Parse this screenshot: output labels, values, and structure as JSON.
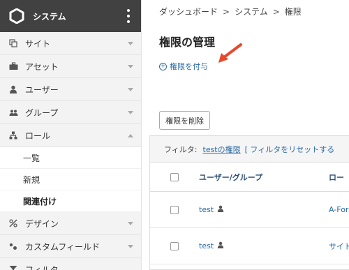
{
  "sidebar": {
    "title": "システム",
    "items": [
      {
        "label": "サイト",
        "icon": "copy-icon",
        "expanded": false
      },
      {
        "label": "アセット",
        "icon": "briefcase-icon",
        "expanded": false
      },
      {
        "label": "ユーザー",
        "icon": "user-icon",
        "expanded": false
      },
      {
        "label": "グループ",
        "icon": "group-icon",
        "expanded": false
      },
      {
        "label": "ロール",
        "icon": "sitemap-icon",
        "expanded": true
      }
    ],
    "role_submenu": [
      "一覧",
      "新規",
      "関連付け"
    ],
    "active_submenu": "関連付け",
    "items_after": [
      {
        "label": "デザイン",
        "icon": "design-icon"
      },
      {
        "label": "カスタムフィールド",
        "icon": "custom-field-icon"
      },
      {
        "label": "フィルタ",
        "icon": "filter-icon"
      }
    ]
  },
  "breadcrumb": {
    "items": [
      "ダッシュボード",
      "システム",
      "権限"
    ],
    "separator": ">"
  },
  "page": {
    "title": "権限の管理",
    "grant_label": "権限を付与",
    "delete_label": "権限を削除"
  },
  "filter": {
    "label": "フィルタ:",
    "current": "testの権限",
    "reset": "[ フィルタをリセットする"
  },
  "table": {
    "headers": [
      "ユーザー/グループ",
      "ロー"
    ],
    "rows": [
      {
        "user": "test",
        "role": "A-For"
      },
      {
        "user": "test",
        "role": "サイト"
      }
    ]
  },
  "colors": {
    "sidebar_header": "#414141",
    "link": "#2a6aa6",
    "arrow": "#e8482c"
  }
}
